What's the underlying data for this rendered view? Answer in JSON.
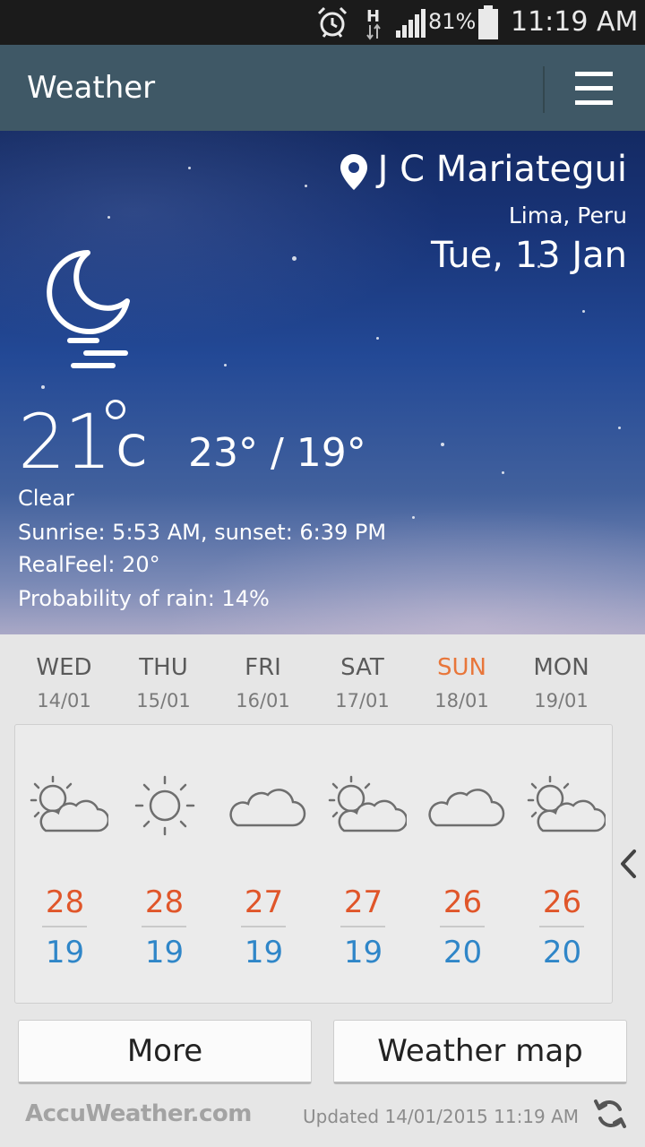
{
  "status_bar": {
    "battery": "81%",
    "time": "11:19 AM",
    "network": "H",
    "icons": [
      "alarm-icon",
      "h-network-icon",
      "signal-icon",
      "battery-icon"
    ]
  },
  "action_bar": {
    "title": "Weather",
    "menu_icon": "hamburger-menu-icon",
    "color": "#3f5866"
  },
  "current": {
    "location": "J C Mariategui",
    "region": "Lima, Peru",
    "date": "Tue, 13 Jan",
    "temperature": "21",
    "unit": "C",
    "hi_lo": "23° / 19°",
    "condition": "Clear",
    "sunrise_sunset": "Sunrise: 5:53  AM, sunset: 6:39  PM",
    "realfeel": "RealFeel: 20°",
    "rain": "Probability of rain: 14%",
    "icon": "moon-fog-icon"
  },
  "forecast": [
    {
      "day": "WED",
      "date": "14/01",
      "icon": "partly-sunny-icon",
      "high": "28",
      "low": "19"
    },
    {
      "day": "THU",
      "date": "15/01",
      "icon": "sunny-icon",
      "high": "28",
      "low": "19"
    },
    {
      "day": "FRI",
      "date": "16/01",
      "icon": "cloudy-icon",
      "high": "27",
      "low": "19"
    },
    {
      "day": "SAT",
      "date": "17/01",
      "icon": "partly-sunny-icon",
      "high": "27",
      "low": "19"
    },
    {
      "day": "SUN",
      "date": "18/01",
      "icon": "cloudy-icon",
      "high": "26",
      "low": "20",
      "highlight": true
    },
    {
      "day": "MON",
      "date": "19/01",
      "icon": "partly-sunny-icon",
      "high": "26",
      "low": "20"
    }
  ],
  "colors": {
    "high_temp": "#e0562a",
    "low_temp": "#2f86c8",
    "sunday": "#e8763a"
  },
  "buttons": {
    "more": "More",
    "weather_map": "Weather map"
  },
  "footer": {
    "logo": "AccuWeather.com",
    "updated": "Updated 14/01/2015 11:19 AM"
  }
}
